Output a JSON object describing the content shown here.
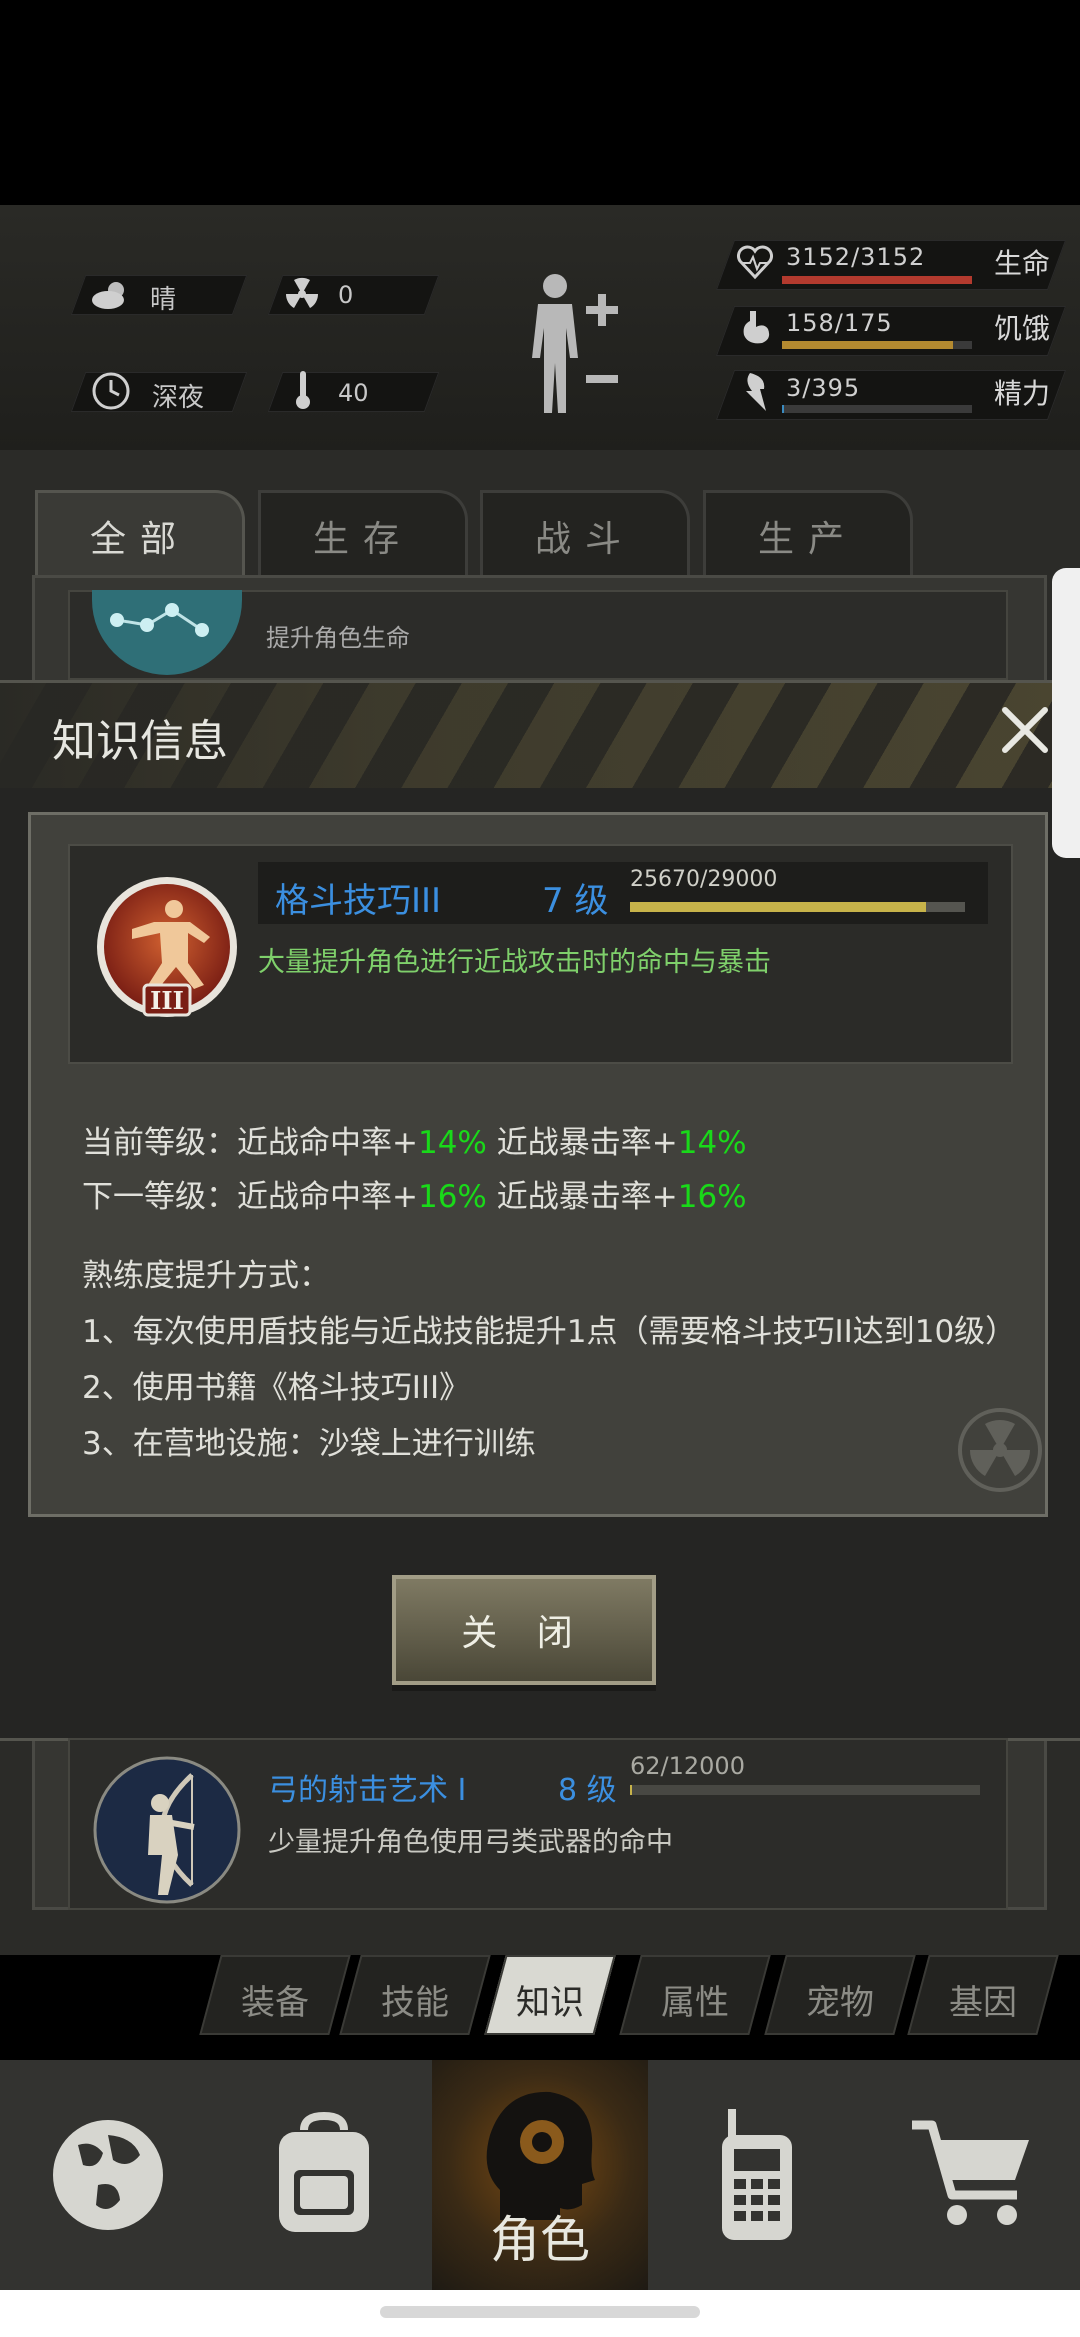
{
  "hud": {
    "weather_label": "晴",
    "radiation_value": "0",
    "time_label": "深夜",
    "temperature_value": "40",
    "stats": [
      {
        "value": "3152/3152",
        "label": "生命",
        "fraction": 1.0,
        "color": "#b33a2e"
      },
      {
        "value": "158/175",
        "label": "饥饿",
        "fraction": 0.9,
        "color": "#b48a30"
      },
      {
        "value": "3/395",
        "label": "精力",
        "fraction": 0.01,
        "color": "#3a8bc0"
      }
    ]
  },
  "category_tabs": [
    "全部",
    "生存",
    "战斗",
    "生产"
  ],
  "behind_item": {
    "desc": "提升角色生命"
  },
  "dialog": {
    "title": "知识信息",
    "skill_name": "格斗技巧III",
    "skill_level": "7 级",
    "xp_text": "25670/29000",
    "xp_fraction": 0.885,
    "skill_desc": "大量提升角色进行近战攻击时的命中与暴击",
    "current_level": {
      "prefix": "当前等级：",
      "hit_label": "近战命中率+",
      "hit_value": "14%",
      "crit_label": "近战暴击率+",
      "crit_value": "14%"
    },
    "next_level": {
      "prefix": "下一等级：",
      "hit_label": "近战命中率+",
      "hit_value": "16%",
      "crit_label": "近战暴击率+",
      "crit_value": "16%"
    },
    "method_title": "熟练度提升方式：",
    "methods": [
      "1、每次使用盾技能与近战技能提升1点（需要格斗技巧II达到10级）",
      "2、使用书籍《格斗技巧III》",
      "3、在营地设施：沙袋上进行训练"
    ],
    "close_label": "关 闭"
  },
  "list_item_2": {
    "name": "弓的射击艺术 I",
    "level": "8 级",
    "xp": "62/12000",
    "xp_fraction": 0.005,
    "desc": "少量提升角色使用弓类武器的命中"
  },
  "sub_tabs": [
    "装备",
    "技能",
    "知识",
    "属性",
    "宠物",
    "基因"
  ],
  "active_sub_tab": "知识",
  "bottom_nav": {
    "active_label": "角色"
  }
}
